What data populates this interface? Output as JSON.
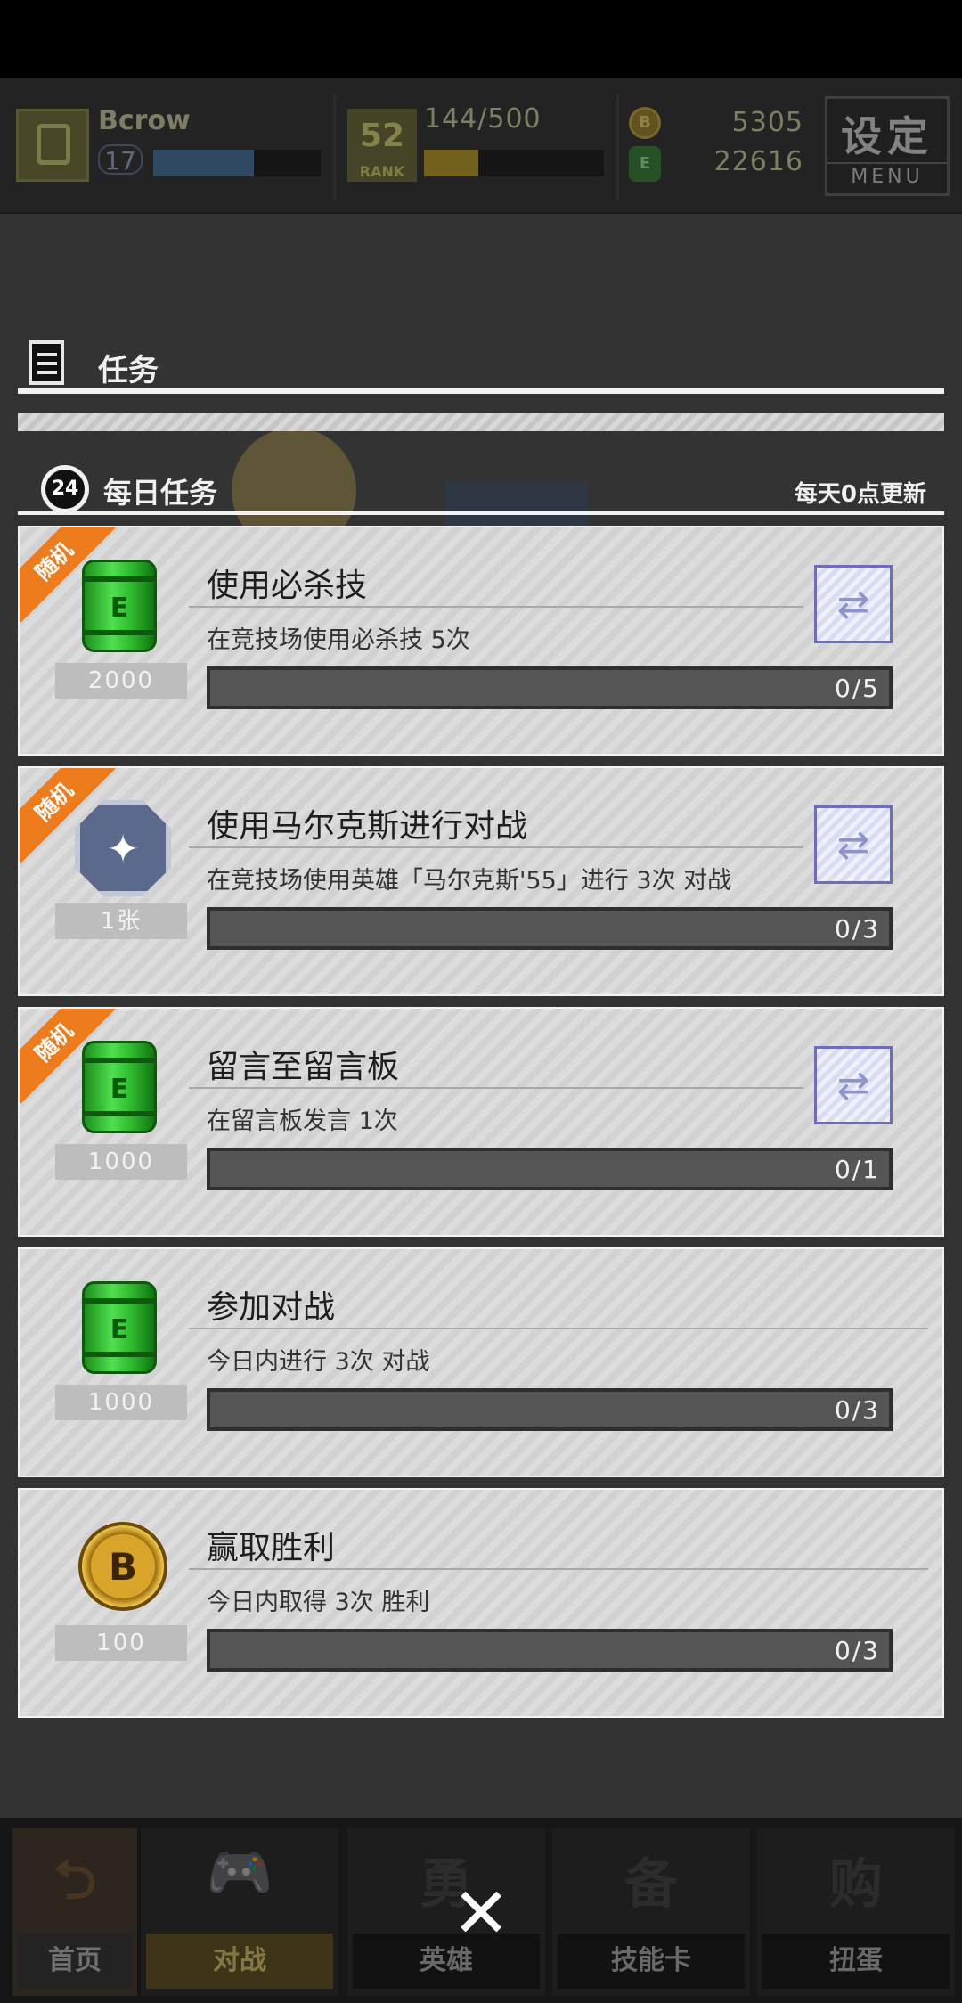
{
  "top_bar": {
    "player_name": "Bcrow",
    "level": "17",
    "rank_icon_text": "RANK",
    "rank_icon_num": "52",
    "rank_progress": "144/500",
    "coins": "5305",
    "gems": "22616",
    "coin_icon_letter": "B",
    "gem_icon_letter": "E",
    "menu_big": "设定",
    "menu_small": "MENU"
  },
  "panel": {
    "title": "任务"
  },
  "daily": {
    "clock_label": "24",
    "title": "每日任务",
    "reset_note": "每天0点更新"
  },
  "tasks": [
    {
      "ribbon": "随机",
      "reward_icon": "green-barrel-icon",
      "reward_qty": "2000",
      "title": "使用必杀技",
      "desc": "在竞技场使用必杀技 5次",
      "progress": "0/5",
      "refreshable": true
    },
    {
      "ribbon": "随机",
      "reward_icon": "hero-card-icon",
      "reward_qty": "1张",
      "title": "使用马尔克斯进行对战",
      "desc": "在竞技场使用英雄「马尔克斯'55」进行 3次 对战",
      "progress": "0/3",
      "refreshable": true
    },
    {
      "ribbon": "随机",
      "reward_icon": "green-barrel-icon",
      "reward_qty": "1000",
      "title": "留言至留言板",
      "desc": "在留言板发言 1次",
      "progress": "0/1",
      "refreshable": true
    },
    {
      "ribbon": "",
      "reward_icon": "green-barrel-icon",
      "reward_qty": "1000",
      "title": "参加对战",
      "desc": "今日内进行 3次 对战",
      "progress": "0/3",
      "refreshable": false
    },
    {
      "ribbon": "",
      "reward_icon": "gold-coin-icon",
      "reward_qty": "100",
      "title": "赢取胜利",
      "desc": "今日内取得 3次 胜利",
      "progress": "0/3",
      "refreshable": false
    }
  ],
  "bottom_nav": {
    "home": "首页",
    "battle": "对战",
    "hero": "英雄",
    "skill_card": "技能卡",
    "gacha": "扭蛋",
    "hero_ico": "勇",
    "skill_ico": "备",
    "gacha_ico": "购"
  },
  "close_glyph": "✕",
  "colors": {
    "ribbon": "#ef7c1c",
    "progress_bg": "#555555",
    "battle_tab_accent": "#d8c36a"
  }
}
